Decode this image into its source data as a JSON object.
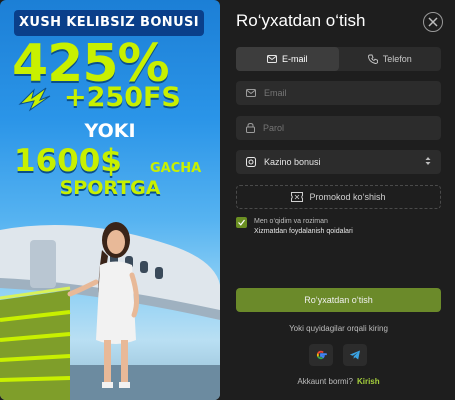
{
  "promo": {
    "header": "XUSH KELIBSIZ BONUSI",
    "percent": "425%",
    "freespins": "+250FS",
    "or": "YOKI",
    "amount": "1600$",
    "gacha": "GACHA",
    "sportga": "SPORTGA"
  },
  "modal": {
    "title": "Ro‘yxatdan o‘tish",
    "tabs": [
      {
        "label": "E-mail",
        "icon": "mail-icon",
        "active": true
      },
      {
        "label": "Telefon",
        "icon": "phone-icon",
        "active": false
      }
    ],
    "email_placeholder": "Email",
    "password_placeholder": "Parol",
    "bonus_select": "Kazino bonusi",
    "promo_code": "Promokod ko‘shish",
    "agree_text": "Men o‘qidim va roziman",
    "agree_link": "Xizmatdan foydalanish qoidalari",
    "submit": "Ro‘yxatdan o‘tish",
    "or_text": "Yoki quyidagilar orqali kiring",
    "account_question": "Akkaunt bormi?",
    "login_link": "Kirish"
  },
  "colors": {
    "accent_green": "#6b8a2a",
    "link_green": "#a5cf3c",
    "promo_lime": "#c8f000",
    "promo_blue": "#0a3f8a",
    "bg": "#1e1e1e",
    "field_bg": "#2c2c2c"
  }
}
